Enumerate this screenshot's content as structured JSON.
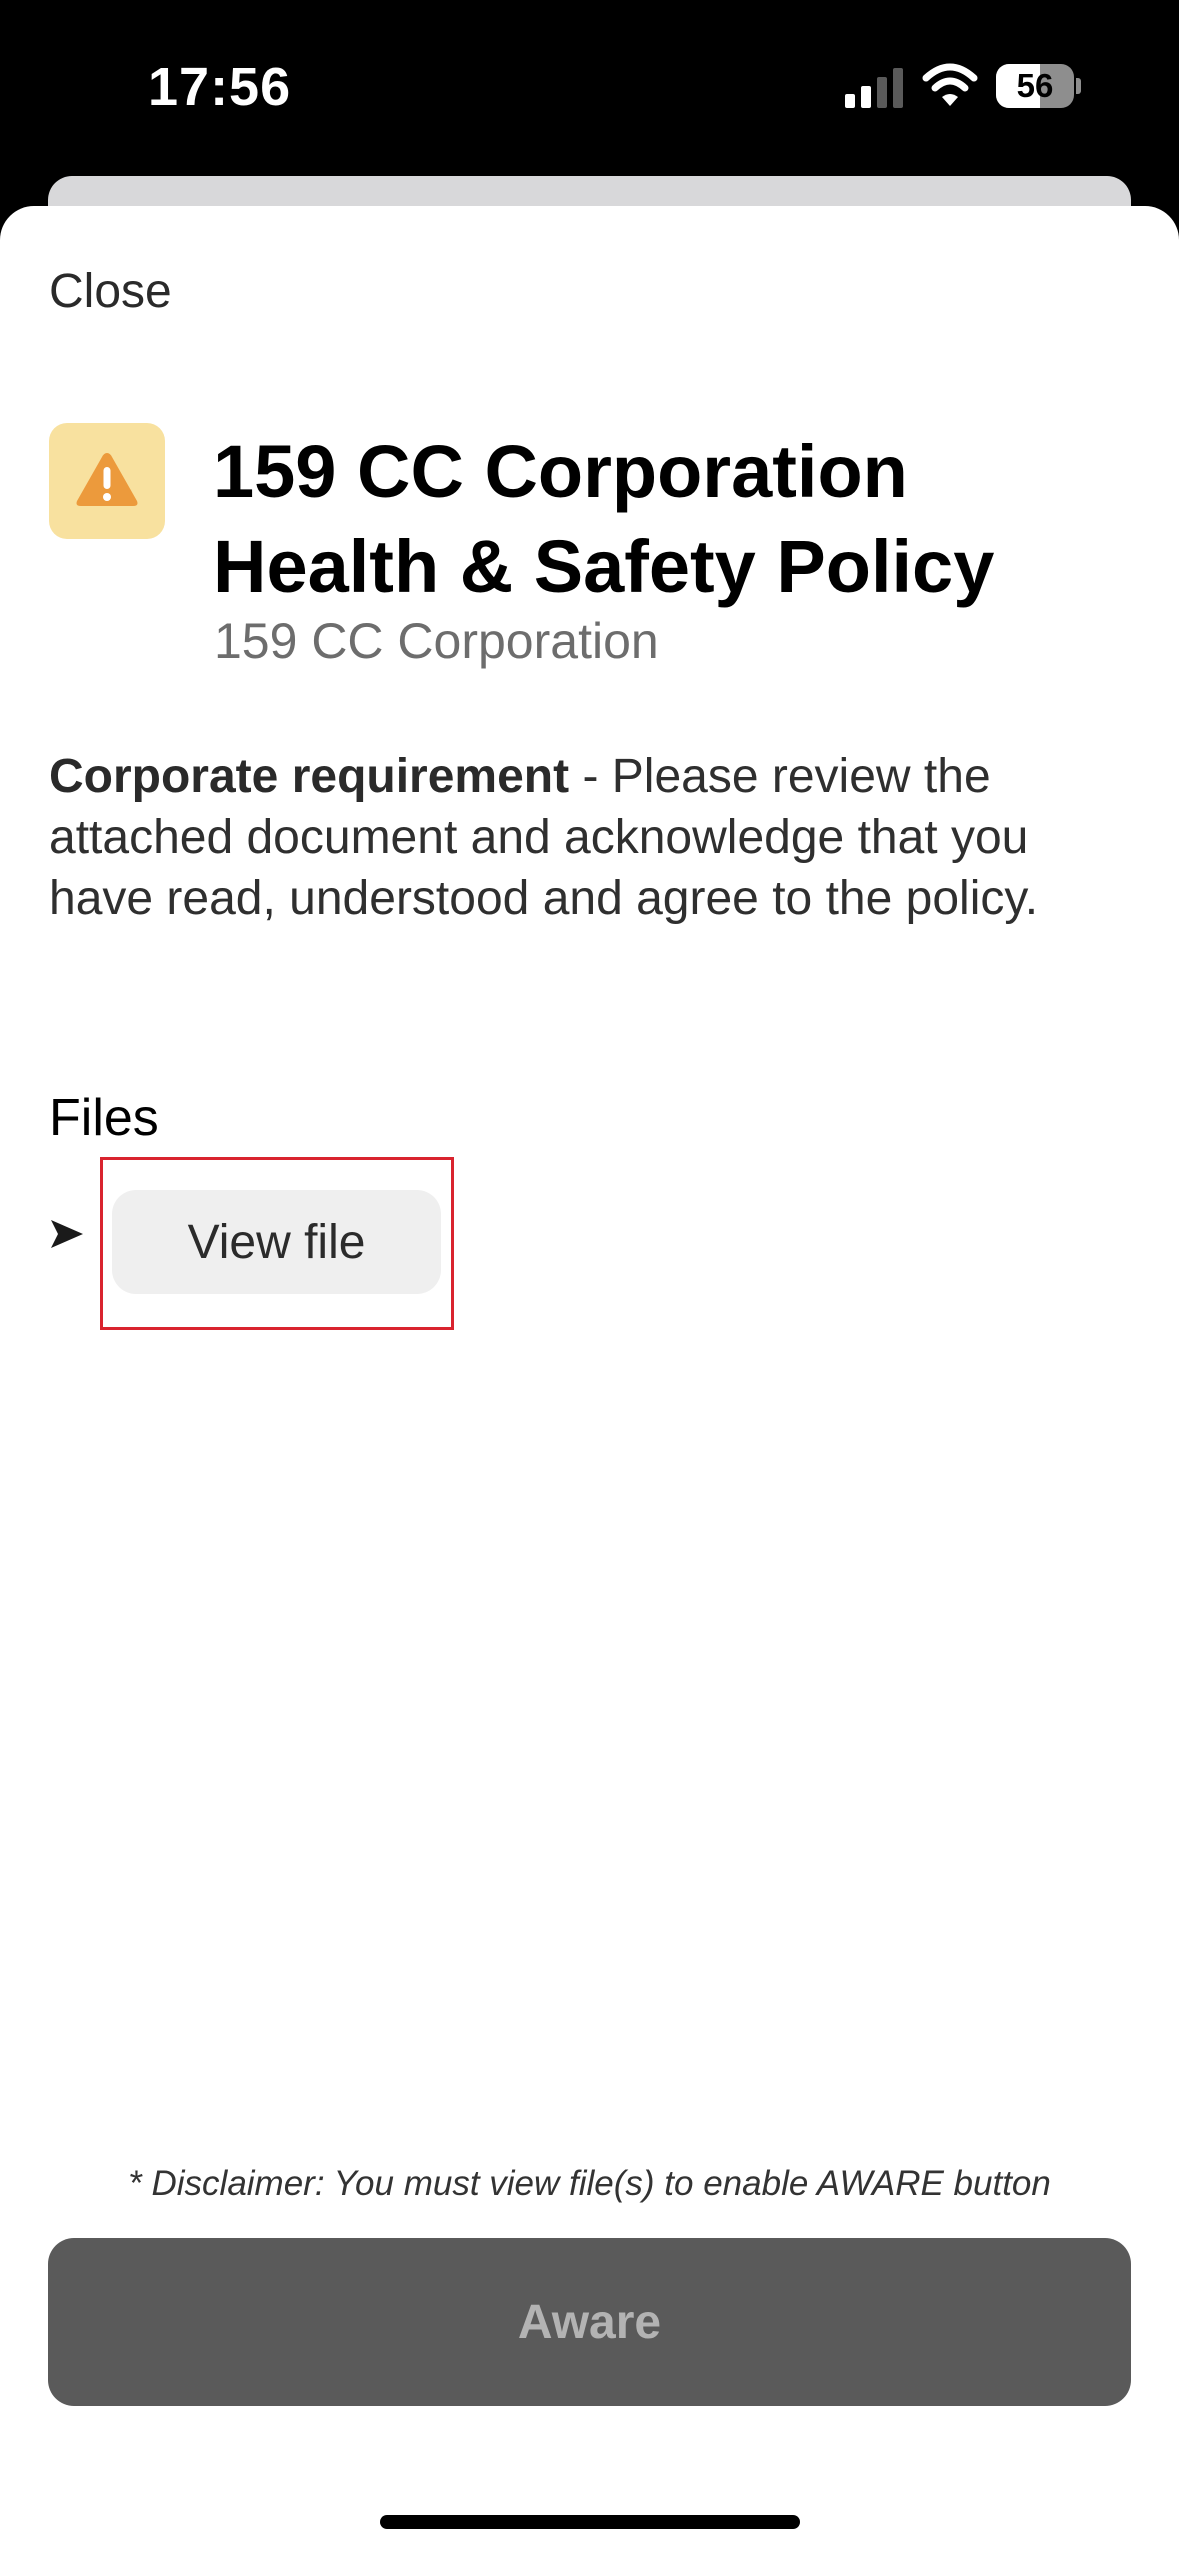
{
  "status_bar": {
    "time": "17:56",
    "battery_level": "56",
    "battery_fraction": 0.56,
    "icons": [
      "signal-icon",
      "wifi-icon",
      "battery-icon"
    ]
  },
  "sheet": {
    "close_label": "Close",
    "icon": "warning-icon",
    "title": "159 CC Corporation Health & Safety Policy",
    "organization": "159 CC Corporation",
    "description_bold": "Corporate requirement",
    "description_rest": " - Please review the attached document and acknowledge that you have read, understood and agree to the policy.",
    "files_heading": "Files",
    "files": [
      {
        "button_label": "View file",
        "icon": "arrow-right-icon"
      }
    ],
    "disclaimer": "* Disclaimer: You must view file(s) to enable AWARE button",
    "aware_label": "Aware"
  },
  "colors": {
    "warning_tile": "#f8e19f",
    "warning_icon": "#ec9a3c",
    "highlight_box": "#d9232e",
    "aware_button_disabled": "#5a5a5a"
  }
}
